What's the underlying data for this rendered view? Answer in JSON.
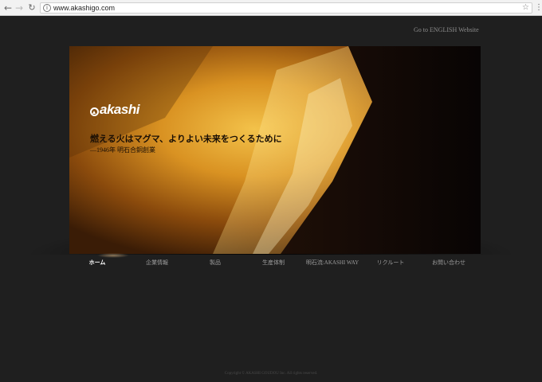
{
  "browser": {
    "url": "www.akashigo.com",
    "icons": {
      "back": "arrow-left-icon",
      "forward": "arrow-right-icon",
      "reload": "reload-icon",
      "info": "info-icon",
      "bookmark": "star-icon",
      "menu": "kebab-menu-icon"
    }
  },
  "header": {
    "english_link": "Go to ENGLISH Website"
  },
  "hero": {
    "logo_text": "akashi",
    "tagline": "燃える火はマグマ、よりよい未来をつくるために",
    "subline": "―1946年 明石合銅創業"
  },
  "nav": {
    "items": [
      {
        "label": "ホーム",
        "active": true
      },
      {
        "label": "企業情報",
        "active": false
      },
      {
        "label": "製品",
        "active": false
      },
      {
        "label": "生産体制",
        "active": false
      },
      {
        "label": "明石流:AKASHI WAY",
        "active": false
      },
      {
        "label": "リクルート",
        "active": false
      },
      {
        "label": "お問い合わせ",
        "active": false
      }
    ]
  },
  "footer": {
    "copyright": "Copyright © AKASHI GOUDOU Inc. All rights reserved."
  },
  "colors": {
    "page_bg": "#1f1f1f",
    "flame": "#e0a030",
    "nav_text": "#9c9c9c",
    "nav_active": "#ffffff"
  }
}
